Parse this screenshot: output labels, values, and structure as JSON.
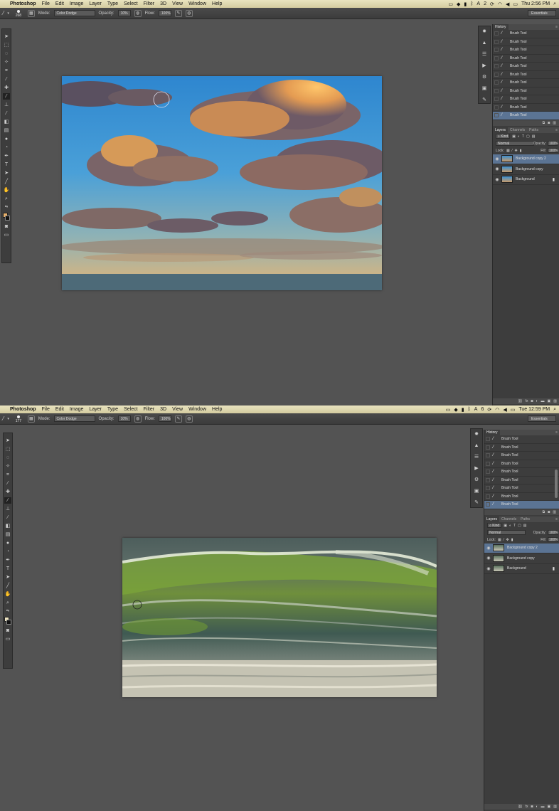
{
  "screenshots": [
    {
      "menubar": {
        "app": "Photoshop",
        "items": [
          "File",
          "Edit",
          "Image",
          "Layer",
          "Type",
          "Select",
          "Filter",
          "3D",
          "View",
          "Window",
          "Help"
        ],
        "status_badge": "2",
        "clock": "Thu 2:56 PM"
      },
      "options": {
        "brush_size": "268",
        "mode_label": "Mode:",
        "mode_value": "Color Dodge",
        "opacity_label": "Opacity:",
        "opacity_value": "10%",
        "flow_label": "Flow:",
        "flow_value": "100%",
        "workspace": "Essentials"
      },
      "swatch": {
        "foreground": "#e8b06a",
        "background": "#111111"
      },
      "history": {
        "tab": "History",
        "item_label": "Brush Tool",
        "items": [
          "Brush Tool",
          "Brush Tool",
          "Brush Tool",
          "Brush Tool",
          "Brush Tool",
          "Brush Tool",
          "Brush Tool",
          "Brush Tool",
          "Brush Tool",
          "Brush Tool",
          "Brush Tool"
        ]
      },
      "layers": {
        "tabs": [
          "Layers",
          "Channels",
          "Paths"
        ],
        "kind": "Kind",
        "blend": "Normal",
        "opacity_label": "Opacity:",
        "opacity_value": "100%",
        "lock_label": "Lock:",
        "fill_label": "Fill:",
        "fill_value": "100%",
        "items": [
          "Background copy 2",
          "Background copy",
          "Background"
        ]
      }
    },
    {
      "menubar": {
        "app": "Photoshop",
        "items": [
          "File",
          "Edit",
          "Image",
          "Layer",
          "Type",
          "Select",
          "Filter",
          "3D",
          "View",
          "Window",
          "Help"
        ],
        "status_badge": "6",
        "clock": "Tue 12:59 PM"
      },
      "options": {
        "brush_size": "177",
        "mode_label": "Mode:",
        "mode_value": "Color Dodge",
        "opacity_label": "Opacity:",
        "opacity_value": "10%",
        "flow_label": "Flow:",
        "flow_value": "100%",
        "workspace": "Essentials"
      },
      "swatch": {
        "foreground": "#efe6c2",
        "background": "#111111"
      },
      "history": {
        "tab": "History",
        "item_label": "Brush Tool",
        "items": [
          "Brush Tool",
          "Brush Tool",
          "Brush Tool",
          "Brush Tool",
          "Brush Tool",
          "Brush Tool",
          "Brush Tool",
          "Brush Tool",
          "Brush Tool"
        ]
      },
      "layers": {
        "tabs": [
          "Layers",
          "Channels",
          "Paths"
        ],
        "kind": "Kind",
        "blend": "Normal",
        "opacity_label": "Opacity:",
        "opacity_value": "100%",
        "lock_label": "Lock:",
        "fill_label": "Fill:",
        "fill_value": "100%",
        "items": [
          "Background copy 2",
          "Background copy",
          "Background"
        ]
      }
    }
  ]
}
